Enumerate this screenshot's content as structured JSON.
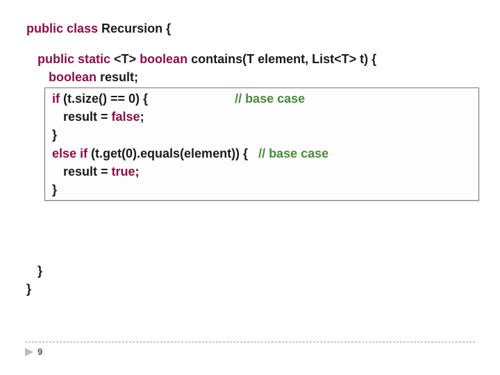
{
  "code": {
    "l1_kw1": "public class ",
    "l1_rest": "Recursion {",
    "l2_kw1": "public static ",
    "l2_rest1": "<T> ",
    "l2_kw2": "boolean ",
    "l2_rest2": "contains(T element, List<T> t) {",
    "l3_kw1": "boolean ",
    "l3_rest": "result;",
    "l4_kw1": "if ",
    "l4_rest": "(t.size() == 0) {                         ",
    "l4_comment": "// base case",
    "l5_rest1": "result = ",
    "l5_kw1": "false",
    "l5_rest2": ";",
    "l6_rest": "}",
    "l7_kw1": "else if ",
    "l7_rest": "(t.get(0).equals(element)) {   ",
    "l7_comment": "// base case",
    "l8_rest1": "result = ",
    "l8_kw1": "true",
    "l8_rest2": ";",
    "l9_rest": "}",
    "l10_rest": "}",
    "l11_rest": "}"
  },
  "footer": {
    "page": "9"
  }
}
